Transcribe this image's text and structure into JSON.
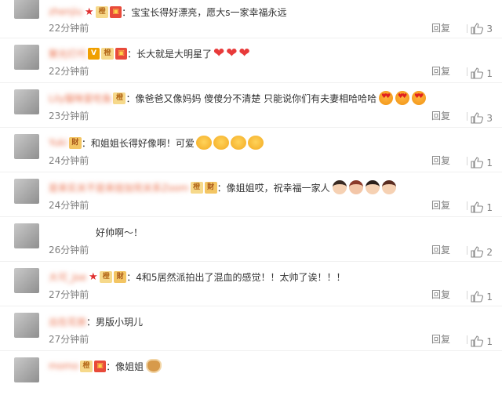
{
  "comments": [
    {
      "user": "zhenjiu",
      "text": "宝宝长得好漂亮，愿大s一家幸福永远",
      "time": "22分钟前",
      "reply": "回复",
      "likes": "3"
    },
    {
      "user": "聚光灯代",
      "text": "长大就是大明星了",
      "time": "22分钟前",
      "reply": "回复",
      "likes": "1"
    },
    {
      "user": "Lily猫咪爱吃鱼",
      "text": "像爸爸又像妈妈 傻傻分不清楚 只能说你们有夫妻相哈哈哈",
      "time": "23分钟前",
      "reply": "回复",
      "likes": "3"
    },
    {
      "user": "Yuki",
      "text": "和姐姐长得好像啊！可爱",
      "time": "24分钟前",
      "reply": "回复",
      "likes": "1"
    },
    {
      "user": "是来实关不是来挂加完关系Zoom",
      "text": "像姐姐哎，祝幸福一家人",
      "time": "24分钟前",
      "reply": "回复",
      "likes": "1"
    },
    {
      "user": "",
      "text": "好帅啊～！",
      "time": "26分钟前",
      "reply": "回复",
      "likes": "2"
    },
    {
      "user": "大可_Joe",
      "text": "4和5居然派拍出了混血的感觉！！太帅了诶！！！",
      "time": "27分钟前",
      "reply": "回复",
      "likes": "1"
    },
    {
      "user": "出在花旅",
      "text": "男版小玥儿",
      "time": "27分钟前",
      "reply": "回复",
      "likes": "1"
    },
    {
      "user": "momo",
      "text": "像姐姐",
      "time": "",
      "reply": "",
      "likes": ""
    }
  ]
}
